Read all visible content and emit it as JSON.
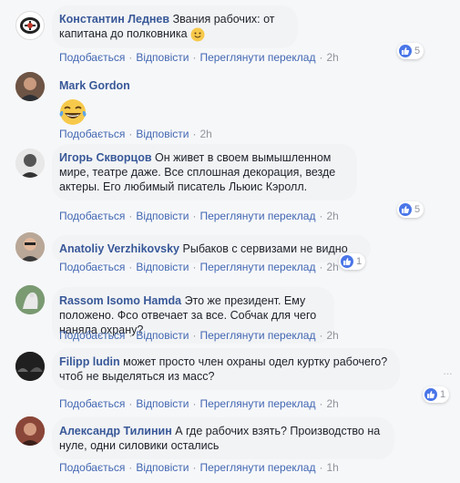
{
  "actions": {
    "like": "Подобається",
    "reply": "Відповісти",
    "translate": "Переглянути переклад",
    "sep": "·"
  },
  "comments": [
    {
      "author": "Константин Леднев",
      "text": "Звания рабочих: от капитана до полковника",
      "emoji": "slightly-smiling-face-icon",
      "time": "2h",
      "reactions": "5",
      "has_translate": true
    },
    {
      "author": "Mark Gordon",
      "text": "",
      "emoji": "laughing-tears-face-icon",
      "time": "2h",
      "reactions": "",
      "has_translate": false
    },
    {
      "author": "Игорь Скворцов",
      "text": "Он живет в своем вымышленном мире, театре даже. Все сплошная декорация, везде актеры. Его любимый писатель Льюис Кэролл.",
      "time": "2h",
      "reactions": "5",
      "has_translate": true
    },
    {
      "author": "Anatoliy Verzhikovsky",
      "text": "Рыбаков с сервизами не видно",
      "time": "2h",
      "reactions": "1",
      "has_translate": true
    },
    {
      "author": "Rassom Isomo Hamda",
      "text": "Это же президент. Ему положено. Фсо отвечает за все. Собчак для чего наняла охрану?",
      "time": "2h",
      "reactions": "",
      "has_translate": true
    },
    {
      "author": "Filipp ludin",
      "text": "может просто член охраны одел куртку рабочего? чтоб не выделяться из масс?",
      "time": "2h",
      "reactions": "1",
      "has_translate": true
    },
    {
      "author": "Александр Тилинин",
      "text": "А где рабочих взять? Производство на нуле, одни силовики остались",
      "time": "1h",
      "reactions": "",
      "has_translate": true
    }
  ],
  "colors": {
    "link": "#385898",
    "action": "#4267b2",
    "meta": "#90949c",
    "bubble": "#f2f3f5",
    "like": "#4a76e8"
  }
}
